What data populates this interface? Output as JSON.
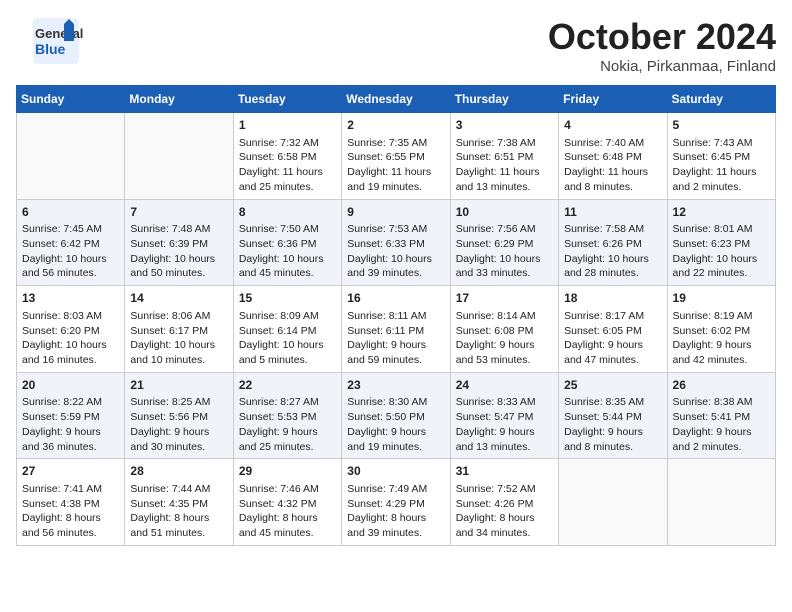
{
  "header": {
    "logo_line1": "General",
    "logo_line2": "Blue",
    "month": "October 2024",
    "location": "Nokia, Pirkanmaa, Finland"
  },
  "days_of_week": [
    "Sunday",
    "Monday",
    "Tuesday",
    "Wednesday",
    "Thursday",
    "Friday",
    "Saturday"
  ],
  "weeks": [
    [
      {
        "day": "",
        "content": ""
      },
      {
        "day": "",
        "content": ""
      },
      {
        "day": "1",
        "content": "Sunrise: 7:32 AM\nSunset: 6:58 PM\nDaylight: 11 hours and 25 minutes."
      },
      {
        "day": "2",
        "content": "Sunrise: 7:35 AM\nSunset: 6:55 PM\nDaylight: 11 hours and 19 minutes."
      },
      {
        "day": "3",
        "content": "Sunrise: 7:38 AM\nSunset: 6:51 PM\nDaylight: 11 hours and 13 minutes."
      },
      {
        "day": "4",
        "content": "Sunrise: 7:40 AM\nSunset: 6:48 PM\nDaylight: 11 hours and 8 minutes."
      },
      {
        "day": "5",
        "content": "Sunrise: 7:43 AM\nSunset: 6:45 PM\nDaylight: 11 hours and 2 minutes."
      }
    ],
    [
      {
        "day": "6",
        "content": "Sunrise: 7:45 AM\nSunset: 6:42 PM\nDaylight: 10 hours and 56 minutes."
      },
      {
        "day": "7",
        "content": "Sunrise: 7:48 AM\nSunset: 6:39 PM\nDaylight: 10 hours and 50 minutes."
      },
      {
        "day": "8",
        "content": "Sunrise: 7:50 AM\nSunset: 6:36 PM\nDaylight: 10 hours and 45 minutes."
      },
      {
        "day": "9",
        "content": "Sunrise: 7:53 AM\nSunset: 6:33 PM\nDaylight: 10 hours and 39 minutes."
      },
      {
        "day": "10",
        "content": "Sunrise: 7:56 AM\nSunset: 6:29 PM\nDaylight: 10 hours and 33 minutes."
      },
      {
        "day": "11",
        "content": "Sunrise: 7:58 AM\nSunset: 6:26 PM\nDaylight: 10 hours and 28 minutes."
      },
      {
        "day": "12",
        "content": "Sunrise: 8:01 AM\nSunset: 6:23 PM\nDaylight: 10 hours and 22 minutes."
      }
    ],
    [
      {
        "day": "13",
        "content": "Sunrise: 8:03 AM\nSunset: 6:20 PM\nDaylight: 10 hours and 16 minutes."
      },
      {
        "day": "14",
        "content": "Sunrise: 8:06 AM\nSunset: 6:17 PM\nDaylight: 10 hours and 10 minutes."
      },
      {
        "day": "15",
        "content": "Sunrise: 8:09 AM\nSunset: 6:14 PM\nDaylight: 10 hours and 5 minutes."
      },
      {
        "day": "16",
        "content": "Sunrise: 8:11 AM\nSunset: 6:11 PM\nDaylight: 9 hours and 59 minutes."
      },
      {
        "day": "17",
        "content": "Sunrise: 8:14 AM\nSunset: 6:08 PM\nDaylight: 9 hours and 53 minutes."
      },
      {
        "day": "18",
        "content": "Sunrise: 8:17 AM\nSunset: 6:05 PM\nDaylight: 9 hours and 47 minutes."
      },
      {
        "day": "19",
        "content": "Sunrise: 8:19 AM\nSunset: 6:02 PM\nDaylight: 9 hours and 42 minutes."
      }
    ],
    [
      {
        "day": "20",
        "content": "Sunrise: 8:22 AM\nSunset: 5:59 PM\nDaylight: 9 hours and 36 minutes."
      },
      {
        "day": "21",
        "content": "Sunrise: 8:25 AM\nSunset: 5:56 PM\nDaylight: 9 hours and 30 minutes."
      },
      {
        "day": "22",
        "content": "Sunrise: 8:27 AM\nSunset: 5:53 PM\nDaylight: 9 hours and 25 minutes."
      },
      {
        "day": "23",
        "content": "Sunrise: 8:30 AM\nSunset: 5:50 PM\nDaylight: 9 hours and 19 minutes."
      },
      {
        "day": "24",
        "content": "Sunrise: 8:33 AM\nSunset: 5:47 PM\nDaylight: 9 hours and 13 minutes."
      },
      {
        "day": "25",
        "content": "Sunrise: 8:35 AM\nSunset: 5:44 PM\nDaylight: 9 hours and 8 minutes."
      },
      {
        "day": "26",
        "content": "Sunrise: 8:38 AM\nSunset: 5:41 PM\nDaylight: 9 hours and 2 minutes."
      }
    ],
    [
      {
        "day": "27",
        "content": "Sunrise: 7:41 AM\nSunset: 4:38 PM\nDaylight: 8 hours and 56 minutes."
      },
      {
        "day": "28",
        "content": "Sunrise: 7:44 AM\nSunset: 4:35 PM\nDaylight: 8 hours and 51 minutes."
      },
      {
        "day": "29",
        "content": "Sunrise: 7:46 AM\nSunset: 4:32 PM\nDaylight: 8 hours and 45 minutes."
      },
      {
        "day": "30",
        "content": "Sunrise: 7:49 AM\nSunset: 4:29 PM\nDaylight: 8 hours and 39 minutes."
      },
      {
        "day": "31",
        "content": "Sunrise: 7:52 AM\nSunset: 4:26 PM\nDaylight: 8 hours and 34 minutes."
      },
      {
        "day": "",
        "content": ""
      },
      {
        "day": "",
        "content": ""
      }
    ]
  ]
}
